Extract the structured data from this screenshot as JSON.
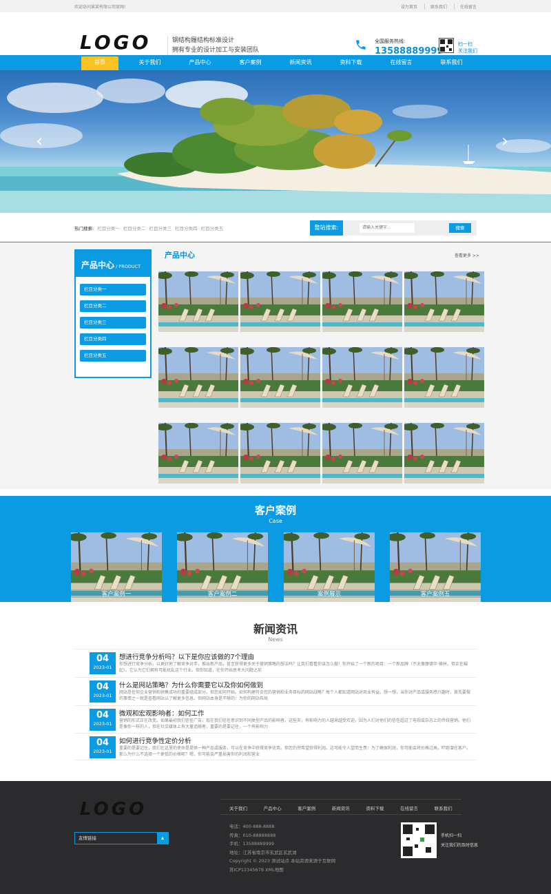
{
  "topbar": {
    "welcome": "欢迎访问某某有限公司官网!",
    "links": [
      "设为首页",
      "联系我们",
      "在线留言"
    ]
  },
  "header": {
    "logo": "LOGO",
    "slogan_line1": "钢结构履结构标准设计",
    "slogan_line2": "拥有专业的设计加工与安装团队",
    "hotline_label": "全国服务热线:",
    "hotline_number": "13588889999",
    "scan_line1": "扫一扫",
    "scan_line2": "关注我们"
  },
  "nav": [
    "首页",
    "关于我们",
    "产品中心",
    "客户案例",
    "新闻资讯",
    "资料下载",
    "在线留言",
    "联系我们"
  ],
  "banner": {
    "prev_icon": "‹",
    "next_icon": "›"
  },
  "search": {
    "hot_label": "热门搜索:",
    "hot_items": [
      "栏目分类一",
      "栏目分类二",
      "栏目分类三",
      "栏目分类四",
      "栏目分类五"
    ],
    "label": "整站搜索:",
    "placeholder": "请输入关键字...",
    "button": "搜索"
  },
  "products": {
    "side_title": "产品中心",
    "side_sub": "/ PRODUCT",
    "categories": [
      "栏目分类一",
      "栏目分类二",
      "栏目分类三",
      "栏目分类四",
      "栏目分类五"
    ],
    "title": "产品中心",
    "more": "查看更多 >>"
  },
  "cases": {
    "title": "客户案例",
    "en": "Case",
    "items": [
      "客户案例一",
      "客户案例二",
      "案例展示",
      "客户案例五"
    ]
  },
  "news": {
    "title": "新闻资讯",
    "en": "News",
    "items": [
      {
        "day": "04",
        "ym": "2023-01",
        "title": "想进行竞争分析吗？以下是你应该做的7个理由",
        "desc": "你想进行竞争分析。以更好地了解竞争对手，推出新产品，甚至获得更多关于营销策略的想法吗？让我们看看你该怎么做！你开始了一个新的项目：一个新品牌（不太像摩德华·格林，但正在崛起）。它认为它们拥有可能扰乱这个行业。但你知道，在你开始思考大问题之前"
      },
      {
        "day": "04",
        "ym": "2023-01",
        "title": "什么是网站策略？为什么你需要它以及你如何做到",
        "desc": "网站是任何企业营销和销售成功的重要组成部分。但您如何开始。如何构建符合您的营销和业务目标的网站战略？每个人都知道网站对商业有益。想一想，当你对产品或服务感兴趣时，首先要做的事情之一就是查看网站以了解更多信息。但网站本身是不够的：为你的网站布局"
      },
      {
        "day": "04",
        "ym": "2023-01",
        "title": "微观和宏观影响者：如何工作",
        "desc": "营销的形式正在改变。如果最初我们信任广告，现在我们信任意识到不同类型产品的影响者。这些天，有影响力的人越来越受欢迎，因为人们对他们的信任超过了电视或杂志上的传统营销。他们是像你一样的人，但在社交媒体上有大量追随者，重要的是要记住，一个有影响力"
      },
      {
        "day": "04",
        "ym": "2023-01",
        "title": "如何进行竞争性定价分析",
        "desc": "重要的是要记住，我们在这里的使命是提供一种产品或服务，可以在竞争中获得竞争优势。但您仍然希望获得利润。这可能令人望而生畏：为了确保利润，你可能会将价格过高，吓跑潜在客户。那么为什么不选择一个更低的价格呢？嗯，你可能会严重损害你的利润和营业"
      }
    ]
  },
  "footer": {
    "logo": "LOGO",
    "friend_links": "友情链接",
    "nav": [
      "关于我们",
      "产品中心",
      "客户案例",
      "新闻资讯",
      "资料下载",
      "在线留言",
      "联系我们"
    ],
    "info": [
      "电话：400-888-8888",
      "传真：010-88888888",
      "手机：13588889999",
      "地址：江苏省南京市玄武区玄武湖",
      "Copyright © 2023 测试站点 本站资源来源于互联网",
      "苏ICP12345678 XML地图"
    ],
    "scan_line1": "手机扫一扫",
    "scan_line2": "关注我们的及时信息"
  },
  "colors": {
    "primary": "#0b9be3",
    "accent": "#f9c322",
    "footer_bg": "#2b2b2e"
  }
}
